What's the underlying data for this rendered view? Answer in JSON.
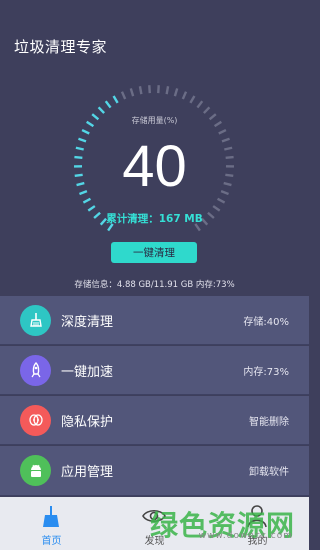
{
  "app": {
    "title": "垃圾清理专家"
  },
  "gauge": {
    "label": "存储用量(%)",
    "value": "40",
    "cleaned": "累计清理：167 MB",
    "fill_fraction": 0.4
  },
  "actions": {
    "one_click_clean": "一键清理"
  },
  "storage_info": "存储信息：4.88 GB/11.91 GB    内存:73%",
  "features": [
    {
      "label": "深度清理",
      "value": "存储:40%",
      "icon": "broom-icon",
      "color": "#2ec6c4"
    },
    {
      "label": "一键加速",
      "value": "内存:73%",
      "icon": "rocket-icon",
      "color": "#7a66e8"
    },
    {
      "label": "隐私保护",
      "value": "智能删除",
      "icon": "privacy-icon",
      "color": "#f45a5a"
    },
    {
      "label": "应用管理",
      "value": "卸载软件",
      "icon": "android-icon",
      "color": "#4fc05a"
    }
  ],
  "tabs": [
    {
      "label": "首页",
      "icon": "broom-icon",
      "active": true,
      "color": "#2a8df0"
    },
    {
      "label": "发现",
      "icon": "eye-icon",
      "active": false
    },
    {
      "label": "我的",
      "icon": "person-icon",
      "active": false
    }
  ],
  "watermark": {
    "text": "绿色资源网",
    "url": "www.downcc.com"
  }
}
